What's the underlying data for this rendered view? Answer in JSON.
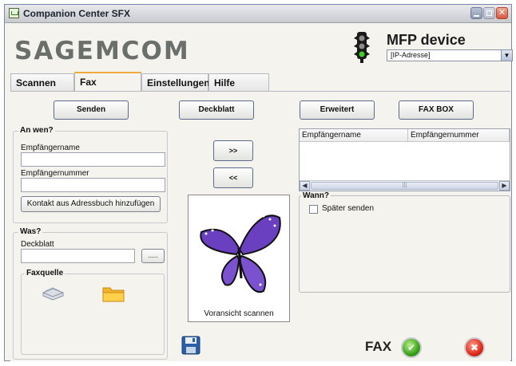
{
  "window": {
    "title": "Companion Center SFX",
    "controls": {
      "minimize": "minimize-icon",
      "maximize": "maximize-icon",
      "close": "close-icon"
    }
  },
  "header": {
    "logo": "SAGEMCOM",
    "device_title": "MFP device",
    "device_select_value": "[IP-Adresse]",
    "device_icon": "traffic-light-icon"
  },
  "tabs": [
    {
      "label": "Scannen"
    },
    {
      "label": "Fax",
      "active": true
    },
    {
      "label": "Einstellungen"
    },
    {
      "label": "Hilfe"
    }
  ],
  "toolbar": {
    "senden": "Senden",
    "deckblatt": "Deckblatt",
    "erweitert": "Erweitert",
    "faxbox": "FAX BOX"
  },
  "an_wen": {
    "legend": "An wen?",
    "name_label": "Empfängername",
    "number_label": "Empfängernummer",
    "add_contact": "Kontakt aus Adressbuch hinzufügen"
  },
  "transfer": {
    "add": ">>",
    "remove": "<<"
  },
  "recipients": {
    "columns": [
      "Empfängername",
      "Empfängernummer"
    ],
    "rows": []
  },
  "was": {
    "legend": "Was?",
    "deckblatt_label": "Deckblatt",
    "browse": ".....",
    "faxquelle_legend": "Faxquelle",
    "sources": [
      "scanner-icon",
      "folder-icon"
    ]
  },
  "preview": {
    "caption": "Voransicht scannen",
    "image": "butterfly-image"
  },
  "wann": {
    "legend": "Wann?",
    "later_label": "Später senden",
    "later_checked": false
  },
  "footer": {
    "fax_label": "FAX",
    "save_icon": "save-icon",
    "ok_icon": "checkmark-icon",
    "cancel_icon": "cancel-icon"
  },
  "colors": {
    "accent_tab": "#f0a93a",
    "ok": "#3aa21a",
    "cancel": "#e02a1a",
    "logo": "#6a6f6c"
  }
}
